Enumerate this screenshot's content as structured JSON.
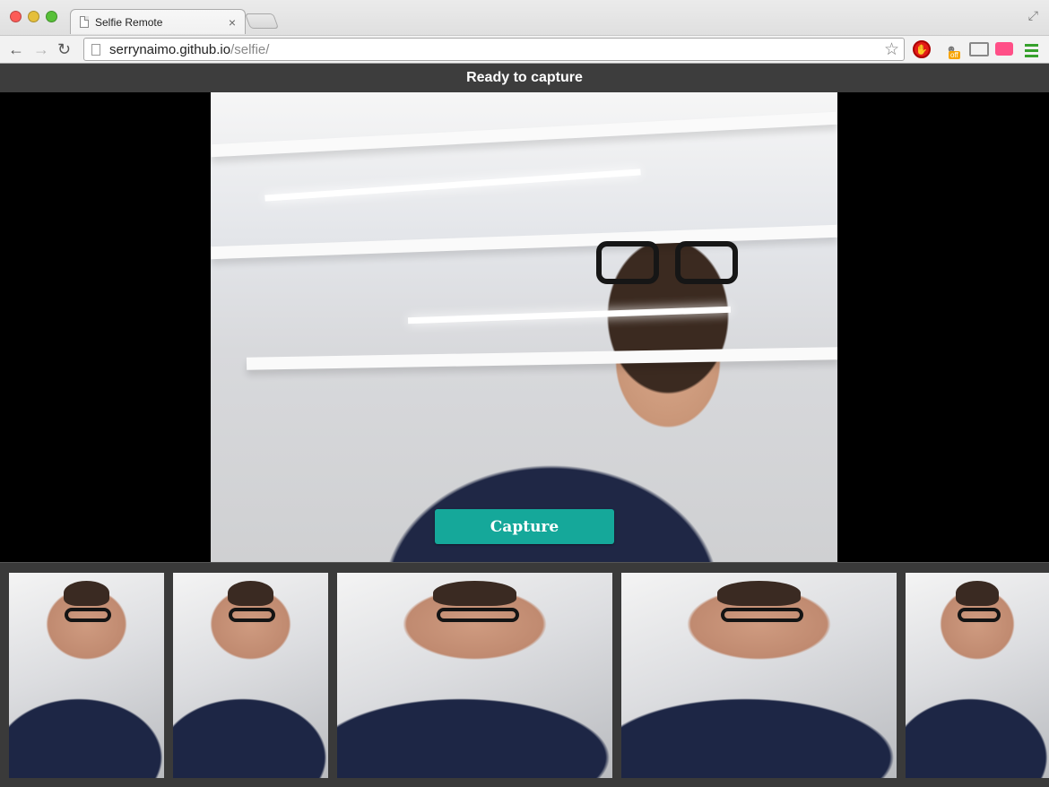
{
  "browser": {
    "tab_title": "Selfie Remote",
    "tab_close": "×",
    "url_host": "serrynaimo.github.io",
    "url_path": "/selfie/",
    "ext_off_badge": "off",
    "icons": [
      "back-arrow-icon",
      "forward-arrow-icon",
      "reload-icon",
      "page-icon",
      "star-icon",
      "stop-extension-icon",
      "ghost-extension-icon",
      "cast-icon",
      "pink-extension-icon",
      "menu-icon"
    ]
  },
  "app": {
    "status": "Ready to capture",
    "capture_label": "Capture",
    "accent_color": "#15a89a",
    "thumbnails": [
      {
        "name": "selfie-thumbnail-1"
      },
      {
        "name": "selfie-thumbnail-2"
      },
      {
        "name": "selfie-thumbnail-3"
      },
      {
        "name": "selfie-thumbnail-4"
      },
      {
        "name": "selfie-thumbnail-5"
      }
    ]
  }
}
